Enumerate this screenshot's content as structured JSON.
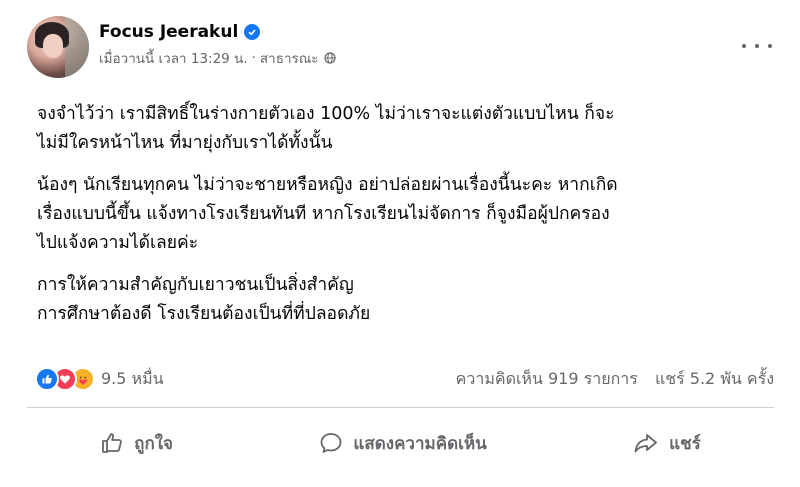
{
  "post": {
    "author": "Focus Jeerakul",
    "timestamp": "เมื่อวานนี้ เวลา 13:29 น.",
    "separator": "·",
    "privacy": "สาธารณะ",
    "paragraphs": [
      [
        "จงจำไว้ว่า เรามีสิทธิ์ในร่างกายตัวเอง 100% ไม่ว่าเราจะแต่งตัวแบบไหน ก็จะ",
        "ไม่มีใครหน้าไหน ที่มายุ่งกับเราได้ทั้งนั้น"
      ],
      [
        "น้องๆ นักเรียนทุกคน ไม่ว่าจะชายหรือหญิง อย่าปล่อยผ่านเรื่องนี้นะคะ หากเกิด",
        "เรื่องแบบนี้ขึ้น แจ้งทางโรงเรียนทันที หากโรงเรียนไม่จัดการ ก็จูงมือผู้ปกครอง",
        "ไปแจ้งความได้เลยค่ะ"
      ],
      [
        "การให้ความสำคัญกับเยาวชนเป็นสิ่งสำคัญ",
        "การศึกษาต้องดี โรงเรียนต้องเป็นที่ที่ปลอดภัย"
      ]
    ]
  },
  "stats": {
    "reactions_count": "9.5 หมื่น",
    "comments": "ความคิดเห็น 919 รายการ",
    "shares": "แชร์ 5.2 พัน ครั้ง"
  },
  "actions": {
    "like": "ถูกใจ",
    "comment": "แสดงความคิดเห็น",
    "share": "แชร์"
  },
  "colors": {
    "brand_blue": "#1877f2",
    "love_red": "#f33e58",
    "care_yellow": "#f7b125",
    "secondary_text": "#65676b"
  },
  "icons": [
    "verified-badge-icon",
    "globe-icon",
    "more-options-icon",
    "like-reaction-icon",
    "love-reaction-icon",
    "care-reaction-icon",
    "thumbs-up-icon",
    "comment-icon",
    "share-icon"
  ]
}
